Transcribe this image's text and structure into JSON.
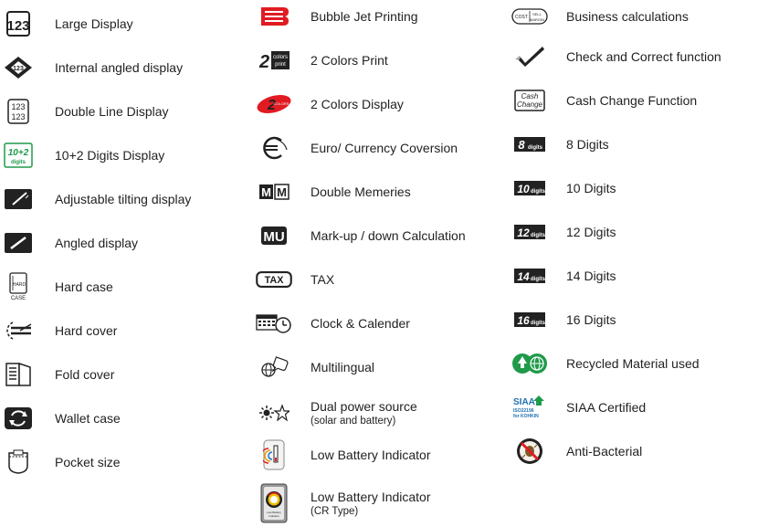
{
  "columns": [
    {
      "items": [
        {
          "icon": "large-display-icon",
          "label": "Large Display"
        },
        {
          "icon": "internal-angled-display-icon",
          "label": "Internal angled display"
        },
        {
          "icon": "double-line-display-icon",
          "label": "Double Line Display"
        },
        {
          "icon": "ten-plus-two-digits-icon",
          "label": "10+2 Digits Display"
        },
        {
          "icon": "adjustable-tilting-display-icon",
          "label": "Adjustable tilting display"
        },
        {
          "icon": "angled-display-icon",
          "label": "Angled display"
        },
        {
          "icon": "hard-case-icon",
          "label": "Hard case"
        },
        {
          "icon": "hard-cover-icon",
          "label": "Hard cover"
        },
        {
          "icon": "fold-cover-icon",
          "label": "Fold cover"
        },
        {
          "icon": "wallet-case-icon",
          "label": "Wallet case"
        },
        {
          "icon": "pocket-size-icon",
          "label": "Pocket size"
        }
      ]
    },
    {
      "items": [
        {
          "icon": "bubble-jet-printing-icon",
          "label": "Bubble Jet Printing"
        },
        {
          "icon": "two-colors-print-icon",
          "label": "2 Colors Print"
        },
        {
          "icon": "two-colors-display-icon",
          "label": "2 Colors Display"
        },
        {
          "icon": "euro-currency-icon",
          "label": "Euro/ Currency Coversion"
        },
        {
          "icon": "double-memories-icon",
          "label": "Double Memeries"
        },
        {
          "icon": "mark-up-icon",
          "label": "Mark-up / down Calculation"
        },
        {
          "icon": "tax-icon",
          "label": "TAX"
        },
        {
          "icon": "clock-calendar-icon",
          "label": "Clock & Calender"
        },
        {
          "icon": "multilingual-icon",
          "label": "Multilingual"
        },
        {
          "icon": "dual-power-icon",
          "label": "Dual power source",
          "sublabel": "(solar and battery)"
        },
        {
          "icon": "low-battery-icon",
          "label": "Low Battery Indicator"
        },
        {
          "icon": "low-battery-cr-icon",
          "label": "Low Battery Indicator",
          "sublabel": "(CR Type)"
        }
      ]
    },
    {
      "items": [
        {
          "icon": "business-calculations-icon",
          "label": "Business calculations"
        },
        {
          "icon": "check-correct-icon",
          "label": "Check and Correct function"
        },
        {
          "icon": "cash-change-icon",
          "label": "Cash Change Function"
        },
        {
          "icon": "eight-digits-icon",
          "label": "8 Digits"
        },
        {
          "icon": "ten-digits-icon",
          "label": "10 Digits"
        },
        {
          "icon": "twelve-digits-icon",
          "label": "12 Digits"
        },
        {
          "icon": "fourteen-digits-icon",
          "label": "14 Digits"
        },
        {
          "icon": "sixteen-digits-icon",
          "label": "16 Digits"
        },
        {
          "icon": "recycled-material-icon",
          "label": "Recycled Material used"
        },
        {
          "icon": "siaa-certified-icon",
          "label": "SIAA Certified"
        },
        {
          "icon": "anti-bacterial-icon",
          "label": "Anti-Bacterial"
        }
      ]
    }
  ],
  "icon_text": {
    "large_display": "123",
    "double_line_top": "123",
    "double_line_bottom": "123",
    "ten_plus_two": "10+2",
    "ten_plus_two_sub": "digits",
    "hard_case": "HARD",
    "hard_case_sub": "CASE",
    "two_colors_num": "2",
    "two_colors_top": "colors",
    "two_colors_bottom": "print",
    "double_mem_a": "M",
    "double_mem_b": "M",
    "mark_up": "MU",
    "tax": "TAX",
    "business_a": "COST",
    "business_b": "SELL",
    "business_c": "MARGIN",
    "cash_top": "Cash",
    "cash_bottom": "Change",
    "d8": "8",
    "d10": "10",
    "d12": "12",
    "d14": "14",
    "d16": "16",
    "digits": "digits",
    "siaa": "SIAA",
    "siaa_sub1": "ISO22196",
    "siaa_sub2": "for KOHKIN",
    "low_batt_cr": "Low Battery Indicator"
  },
  "colors": {
    "accent_red": "#e11b22",
    "icon_green": "#1f9a4a",
    "ink": "#222222"
  }
}
